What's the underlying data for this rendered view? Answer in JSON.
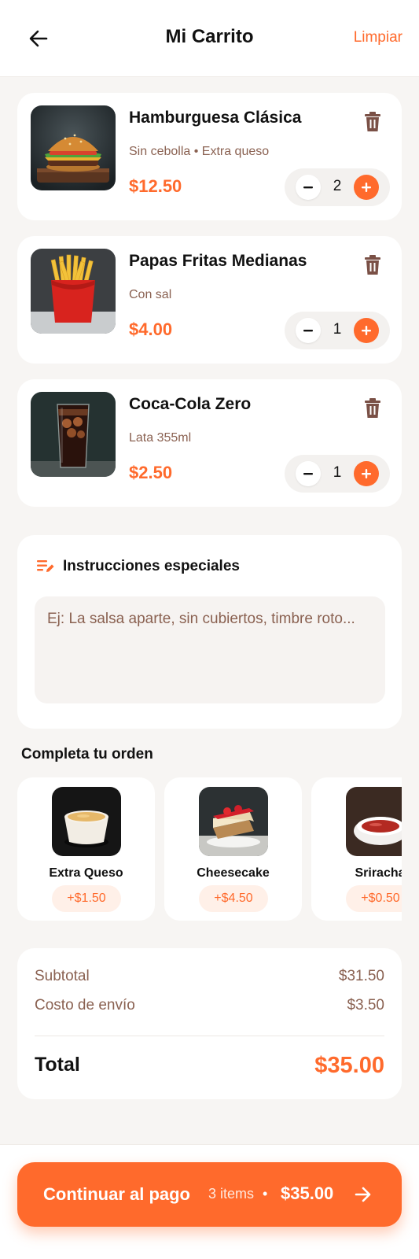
{
  "header": {
    "title": "Mi Carrito",
    "back_icon": "arrow-left-icon",
    "clear_label": "Limpiar"
  },
  "cart": {
    "items": [
      {
        "name": "Hamburguesa Clásica",
        "note": "Sin cebolla • Extra queso",
        "price": "$12.50",
        "quantity": "2",
        "image": "burger-photo"
      },
      {
        "name": "Papas Fritas Medianas",
        "note": "Con sal",
        "price": "$4.00",
        "quantity": "1",
        "image": "fries-photo"
      },
      {
        "name": "Coca-Cola Zero",
        "note": "Lata 355ml",
        "price": "$2.50",
        "quantity": "1",
        "image": "cola-photo"
      }
    ],
    "delete_icon": "trash-icon",
    "minus_icon": "minus-icon",
    "plus_icon": "plus-icon"
  },
  "instructions": {
    "title": "Instrucciones especiales",
    "icon": "edit-notes-icon",
    "placeholder": "Ej: La salsa aparte, sin cubiertos, timbre roto...",
    "value": ""
  },
  "upsell": {
    "title": "Completa tu orden",
    "items": [
      {
        "name": "Extra Queso",
        "price": "+$1.50",
        "image": "cheese-sauce-photo"
      },
      {
        "name": "Cheesecake",
        "price": "+$4.50",
        "image": "cheesecake-photo"
      },
      {
        "name": "Sriracha",
        "price": "+$0.50",
        "image": "sriracha-photo"
      }
    ]
  },
  "summary": {
    "subtotal_label": "Subtotal",
    "subtotal_value": "$31.50",
    "shipping_label": "Costo de envío",
    "shipping_value": "$3.50",
    "total_label": "Total",
    "total_value": "$35.00"
  },
  "checkout": {
    "label": "Continuar al pago",
    "items_count": "3 items",
    "separator": "•",
    "total": "$35.00",
    "arrow_icon": "arrow-right-icon"
  },
  "colors": {
    "accent": "#ff6a2c",
    "muted_text": "#8a6151",
    "background": "#f7f5f3"
  }
}
